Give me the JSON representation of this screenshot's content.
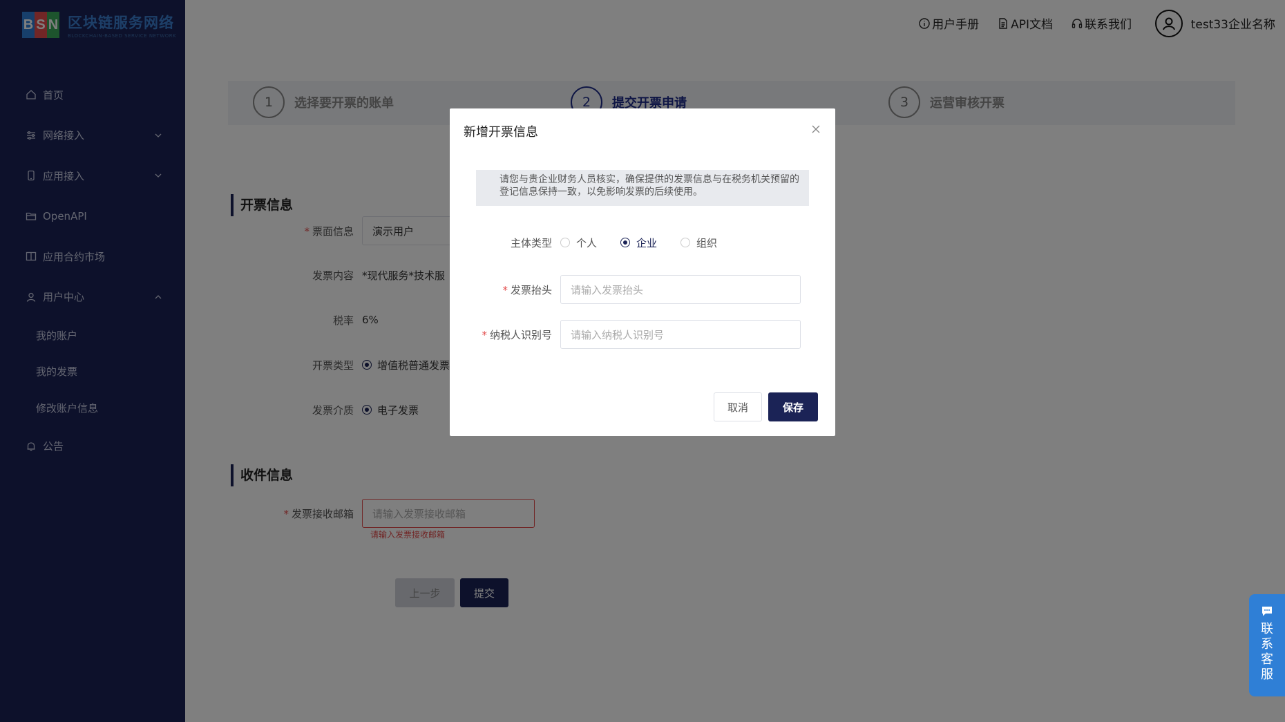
{
  "brand": {
    "letters": [
      "B",
      "S",
      "N"
    ],
    "letter_colors": [
      "#2f7fd6",
      "#e34d4d",
      "#3aa85a"
    ],
    "name": "区块链服务网络",
    "tagline": "BLOCKCHAIN-BASED SERVICE NETWORK"
  },
  "sidebar": {
    "items": [
      {
        "label": "首页",
        "icon": "home-icon"
      },
      {
        "label": "网络接入",
        "icon": "sliders-icon",
        "expandable": true
      },
      {
        "label": "应用接入",
        "icon": "phone-icon",
        "expandable": true
      },
      {
        "label": "OpenAPI",
        "icon": "folder-icon"
      },
      {
        "label": "应用合约市场",
        "icon": "book-icon"
      },
      {
        "label": "用户中心",
        "icon": "user-icon",
        "expanded": true
      }
    ],
    "sub_items": [
      "我的账户",
      "我的发票",
      "修改账户信息"
    ],
    "last_item": {
      "label": "公告",
      "icon": "bell-icon"
    }
  },
  "header": {
    "links": [
      {
        "label": "用户手册",
        "icon": "info-icon"
      },
      {
        "label": "API文档",
        "icon": "document-icon"
      },
      {
        "label": "联系我们",
        "icon": "headset-icon"
      }
    ],
    "user_name": "test33企业名称"
  },
  "steps": [
    {
      "num": "1",
      "label": "选择要开票的账单"
    },
    {
      "num": "2",
      "label": "提交开票申请",
      "active": true
    },
    {
      "num": "3",
      "label": "运营审核开票"
    }
  ],
  "invoice_section": {
    "title": "开票信息",
    "title_label": "票面信息",
    "title_value": "演示用户",
    "content_label": "发票内容",
    "content_value": "*现代服务*技术服",
    "tax_label": "税率",
    "tax_value": "6%",
    "type_label": "开票类型",
    "type_value": "增值税普通发票",
    "medium_label": "发票介质",
    "medium_value": "电子发票"
  },
  "delivery_section": {
    "title": "收件信息",
    "email_label": "发票接收邮箱",
    "email_placeholder": "请输入发票接收邮箱",
    "email_error": "请输入发票接收邮箱"
  },
  "actions": {
    "prev": "上一步",
    "submit": "提交"
  },
  "modal": {
    "title": "新增开票信息",
    "notice": "请您与贵企业财务人员核实，确保提供的发票信息与在税务机关预留的登记信息保持一致，以免影响发票的后续使用。",
    "entity_label": "主体类型",
    "entity_options": [
      "个人",
      "企业",
      "组织"
    ],
    "entity_selected": "企业",
    "header_label": "发票抬头",
    "header_placeholder": "请输入发票抬头",
    "taxid_label": "纳税人识别号",
    "taxid_placeholder": "请输入纳税人识别号",
    "cancel": "取消",
    "save": "保存"
  },
  "float_service": {
    "label": "联系客服",
    "icon": "chat-icon"
  },
  "colors": {
    "sidebar": "#1b2356",
    "primary": "#1b2356",
    "error": "#e34d4d",
    "service": "#2f7fd6"
  }
}
